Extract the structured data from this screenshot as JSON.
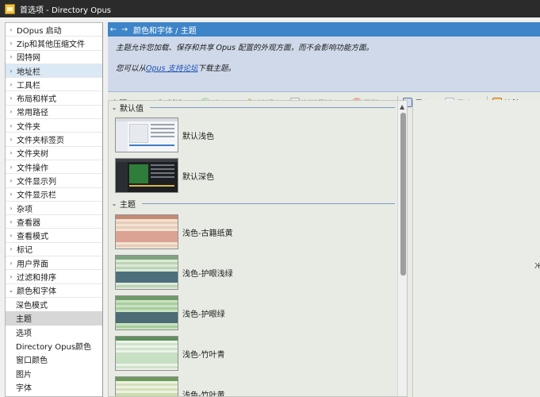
{
  "window": {
    "title": "首选项 - Directory Opus"
  },
  "sidebar": {
    "items": [
      {
        "label": "DOpus 启动",
        "arrow": "›"
      },
      {
        "label": "Zip和其他压缩文件",
        "arrow": "›"
      },
      {
        "label": "因特网",
        "arrow": "›"
      },
      {
        "label": "地址栏",
        "arrow": "›"
      },
      {
        "label": "工具栏",
        "arrow": "›"
      },
      {
        "label": "布局和样式",
        "arrow": "›"
      },
      {
        "label": "常用路径",
        "arrow": "›"
      },
      {
        "label": "文件夹",
        "arrow": "›"
      },
      {
        "label": "文件夹标签页",
        "arrow": "›"
      },
      {
        "label": "文件夹树",
        "arrow": "›"
      },
      {
        "label": "文件操作",
        "arrow": "›"
      },
      {
        "label": "文件显示列",
        "arrow": "›"
      },
      {
        "label": "文件显示栏",
        "arrow": "›"
      },
      {
        "label": "杂项",
        "arrow": "›"
      },
      {
        "label": "查看器",
        "arrow": "›"
      },
      {
        "label": "查看模式",
        "arrow": "›"
      },
      {
        "label": "标记",
        "arrow": "›"
      },
      {
        "label": "用户界面",
        "arrow": "›"
      },
      {
        "label": "过滤和排序",
        "arrow": "›"
      },
      {
        "label": "颜色和字体",
        "arrow": "⌄"
      }
    ],
    "subitems": [
      {
        "label": "深色模式"
      },
      {
        "label": "主题"
      },
      {
        "label": "选项"
      },
      {
        "label": "Directory Opus颜色"
      },
      {
        "label": "窗口颜色"
      },
      {
        "label": "图片"
      },
      {
        "label": "字体"
      }
    ]
  },
  "header": {
    "back": "←",
    "forward": "→",
    "title": "颜色和字体 / 主题"
  },
  "info": {
    "line1": "主题允许您加载、保存和共享 Opus 配置的外观方面，而不会影响功能方面。",
    "line2_pre": "您可以从",
    "line2_link": "Opus 支持论坛",
    "line2_post": "下载主题。"
  },
  "toolbar": {
    "label": "主题",
    "new": "新建(C)",
    "apply": "应用(D)",
    "edit": "编辑(E)",
    "copy": "创建副本(G)",
    "delete": "删除(H)",
    "import": "导入(I)",
    "export": "导出(J)",
    "clear": "清除(K)"
  },
  "groups": {
    "default": "默认值",
    "themes": "主题"
  },
  "themes": [
    {
      "label": "默认浅色"
    },
    {
      "label": "默认深色"
    },
    {
      "label": "浅色-古籍纸黄"
    },
    {
      "label": "浅色-护眼浅绿"
    },
    {
      "label": "浅色-护眼绿"
    },
    {
      "label": "浅色-竹叶青"
    },
    {
      "label": "浅色-竹叶黄"
    }
  ],
  "preview": {
    "glyph": "Ж"
  },
  "colors": {
    "accent": "#3d84c8",
    "info_bg": "#cfd9ea",
    "sidebar_sel": "#dbe8f5"
  }
}
